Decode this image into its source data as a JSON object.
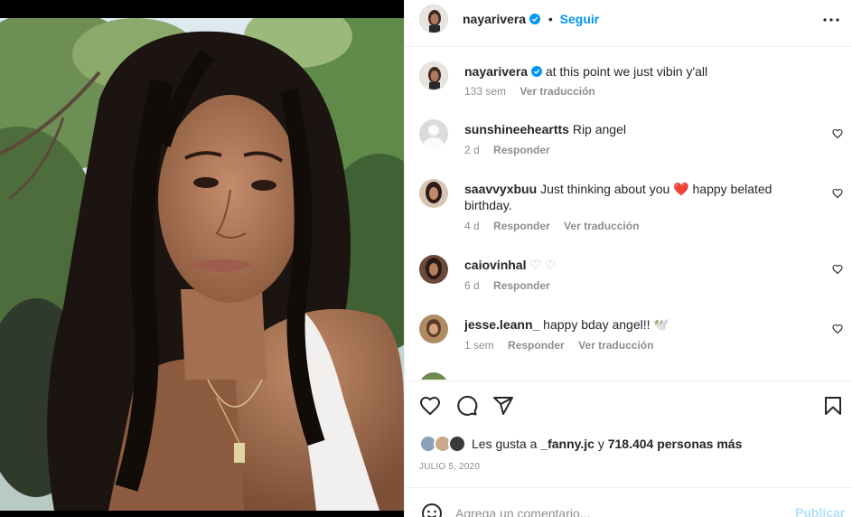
{
  "post": {
    "username": "nayarivera",
    "follow_label": "Seguir",
    "separator": "•",
    "icons": {
      "more": "more-options-icon",
      "verified": "verified-badge-icon"
    }
  },
  "caption": {
    "username": "nayarivera",
    "text": "at this point we just vibin y'all",
    "time": "133 sem",
    "translate": "Ver traducción"
  },
  "comments": [
    {
      "username": "sunshineeheartts",
      "text": "Rip angel",
      "time": "2 d",
      "reply": "Responder",
      "translate": ""
    },
    {
      "username": "saavvyxbuu",
      "text_before": "Just thinking about you",
      "emoji": "❤️",
      "text_after": "happy belated birthday.",
      "time": "4 d",
      "reply": "Responder",
      "translate": "Ver traducción"
    },
    {
      "username": "caiovinhal",
      "text": "♡ ♡",
      "time": "6 d",
      "reply": "Responder",
      "translate": ""
    },
    {
      "username": "jesse.leann_",
      "text": "happy bday angel!! 🕊️",
      "time": "1 sem",
      "reply": "Responder",
      "translate": "Ver traducción"
    }
  ],
  "actions": {
    "icons": [
      "heart-icon",
      "comment-icon",
      "share-icon",
      "bookmark-icon"
    ]
  },
  "likes": {
    "prefix": "Les gusta a",
    "user": "_fanny.jc",
    "connector": "y",
    "count": "718.404 personas más"
  },
  "date": "JULIO 5, 2020",
  "add_comment": {
    "placeholder": "Agrega un comentario...",
    "publish": "Publicar"
  },
  "colors": {
    "accent": "#0095f6",
    "publish_disabled": "#b2dffc",
    "muted": "#8e8e8e",
    "heart_red": "#ed4956"
  }
}
